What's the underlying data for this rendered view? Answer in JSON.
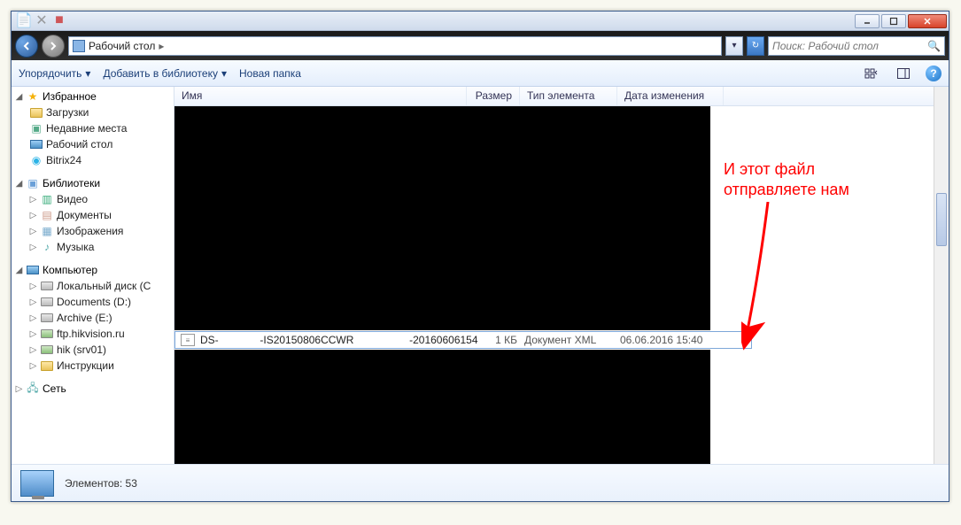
{
  "window": {
    "location_label": "Рабочий стол",
    "breadcrumb_sep": "▸"
  },
  "search": {
    "placeholder": "Поиск: Рабочий стол"
  },
  "toolbar": {
    "organize": "Упорядочить",
    "add_library": "Добавить в библиотеку",
    "new_folder": "Новая папка"
  },
  "sidebar": {
    "favorites": {
      "label": "Избранное",
      "items": [
        {
          "label": "Загрузки"
        },
        {
          "label": "Недавние места"
        },
        {
          "label": "Рабочий стол"
        },
        {
          "label": "Bitrix24"
        }
      ]
    },
    "libraries": {
      "label": "Библиотеки",
      "items": [
        {
          "label": "Видео"
        },
        {
          "label": "Документы"
        },
        {
          "label": "Изображения"
        },
        {
          "label": "Музыка"
        }
      ]
    },
    "computer": {
      "label": "Компьютер",
      "items": [
        {
          "label": "Локальный диск (C"
        },
        {
          "label": "Documents (D:)"
        },
        {
          "label": "Archive (E:)"
        },
        {
          "label": "ftp.hikvision.ru"
        },
        {
          "label": "hik (srv01)"
        },
        {
          "label": "Инструкции"
        }
      ]
    },
    "network": {
      "label": "Сеть"
    }
  },
  "columns": {
    "name": "Имя",
    "size": "Размер",
    "type": "Тип элемента",
    "date": "Дата изменения"
  },
  "file": {
    "name_prefix": "DS-",
    "name_mid": "-IS20150806CCWR",
    "name_suffix": "-201606061540.xml",
    "size": "1 КБ",
    "type": "Документ XML",
    "date": "06.06.2016 15:40"
  },
  "annotation": {
    "line1": "И этот файл",
    "line2": "отправляете нам"
  },
  "status": {
    "text": "Элементов: 53"
  }
}
